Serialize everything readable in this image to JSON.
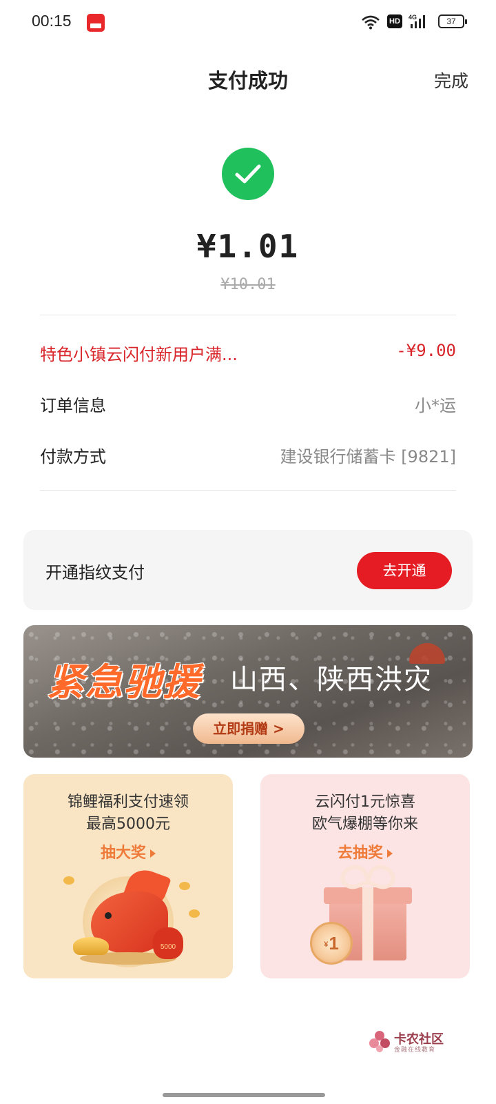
{
  "status_bar": {
    "time": "00:15",
    "network_badge": "HD",
    "network_type": "4G",
    "battery": "37"
  },
  "header": {
    "title": "支付成功",
    "done_label": "完成"
  },
  "payment": {
    "amount": "¥1.01",
    "original_amount": "¥10.01",
    "status": "success"
  },
  "details": {
    "discount": {
      "label": "特色小镇云闪付新用户满...",
      "value": "-¥9.00"
    },
    "order": {
      "label": "订单信息",
      "value": "小*运"
    },
    "method": {
      "label": "付款方式",
      "value": "建设银行储蓄卡 [9821]"
    }
  },
  "fingerprint": {
    "label": "开通指纹支付",
    "button": "去开通"
  },
  "banner": {
    "headline": "紧急驰援",
    "subtitle": "山西、陕西洪灾",
    "cta": "立即捐赠 >"
  },
  "promos": [
    {
      "line1": "锦鲤福利支付速领",
      "line2": "最高5000元",
      "action": "抽大奖",
      "badge": "5000"
    },
    {
      "line1": "云闪付1元惊喜",
      "line2": "欧气爆棚等你来",
      "action": "去抽奖",
      "coin": "1"
    }
  ],
  "watermark": {
    "name": "卡农社区",
    "tagline": "金融在线教育"
  },
  "colors": {
    "accent_red": "#e51c23",
    "success_green": "#20c05c",
    "discount_red": "#d9262b"
  }
}
